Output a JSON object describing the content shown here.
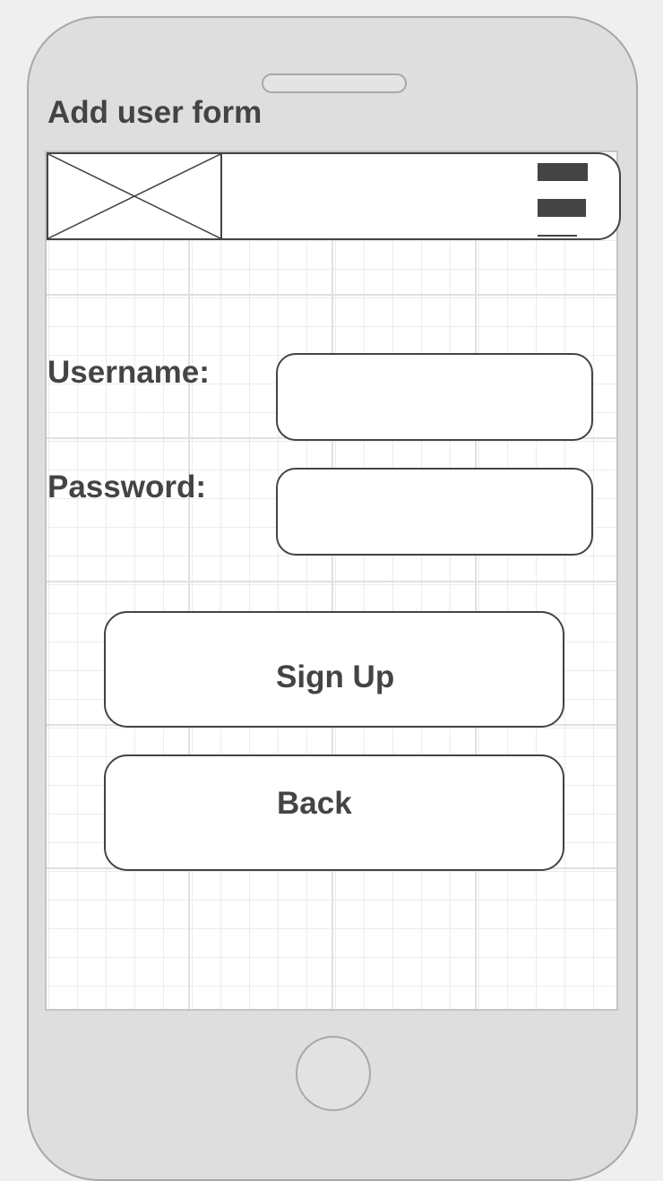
{
  "screen": {
    "title": "Add user form"
  },
  "header": {
    "logo_icon": "image-placeholder-icon",
    "menu_icon": "hamburger-menu-icon"
  },
  "form": {
    "username_label": "Username:",
    "username_value": "",
    "password_label": "Password:",
    "password_value": ""
  },
  "buttons": {
    "signup_label": "Sign Up",
    "back_label": "Back"
  },
  "colors": {
    "ink": "#444444",
    "device_body": "#dedede",
    "device_border": "#a8a8a8",
    "grid": "#e0e0e0"
  }
}
